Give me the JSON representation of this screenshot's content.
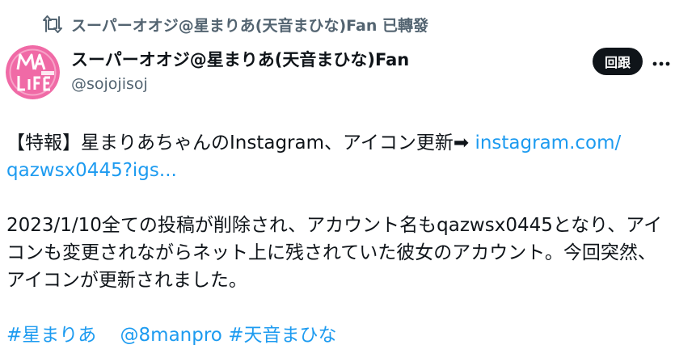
{
  "retweet": {
    "icon": "retweet-icon",
    "text": "スーパーオオジ@星まりあ(天音まひな)Fan 已轉發"
  },
  "author": {
    "avatar_icon": "avatar-logo",
    "display_name": "スーパーオオジ@星まりあ(天音まひな)Fan",
    "handle": "@sojojisoj"
  },
  "actions": {
    "follow_label": "回跟",
    "more_icon": "more-icon"
  },
  "tweet": {
    "line1_text": "【特報】星まりあちゃんのInstagram、アイコン更新➡ ",
    "link_part1": "instagram.com/",
    "link_part2": "qazwsx0445?igs...",
    "paragraph2": "2023/1/10全ての投稿が削除され、アカウント名もqazwsx0445となり、アイコンも変更されながらネット上に残されていた彼女のアカウント。今回突然、アイコンが更新されました。",
    "hashtag1": "#星まりあ",
    "mention": "@8manpro",
    "hashtag2": "#天音まひな"
  },
  "colors": {
    "link": "#1d9bf0",
    "text": "#0f1419",
    "secondary": "#536471",
    "avatar_pink": "#f06aa6"
  }
}
